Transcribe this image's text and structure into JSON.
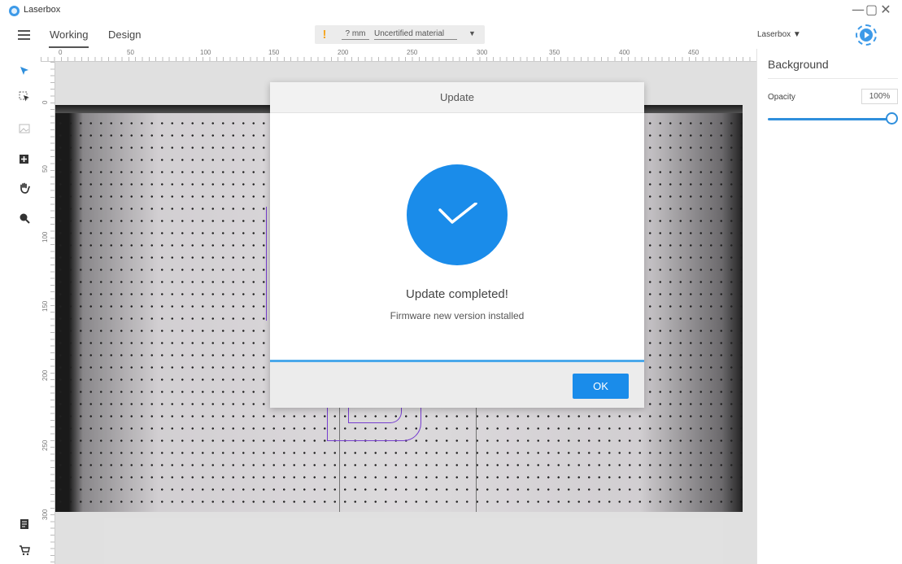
{
  "app": {
    "title": "Laserbox"
  },
  "window_controls": {
    "minimize": "—",
    "maximize": "▢",
    "close": "✕"
  },
  "header": {
    "tabs": [
      {
        "label": "Working",
        "active": true
      },
      {
        "label": "Design",
        "active": false
      }
    ],
    "warning_icon": "!",
    "thickness_value": "? mm",
    "material_value": "Uncertified material",
    "material_caret": "▼",
    "device_select": "Laserbox ▼"
  },
  "toolbar": {
    "tools": [
      "select-arrow-icon",
      "select-area-icon",
      "image-icon",
      "add-shape-icon",
      "hand-icon",
      "zoom-icon"
    ],
    "bottom_tools": [
      "notes-icon",
      "cart-icon"
    ]
  },
  "ruler": {
    "top_labels": [
      "0",
      "50",
      "100",
      "150",
      "200",
      "250",
      "300",
      "350",
      "400",
      "450"
    ],
    "left_labels": [
      "0",
      "50",
      "100",
      "150",
      "200",
      "250",
      "300"
    ]
  },
  "panel": {
    "title": "Background",
    "opacity_label": "Opacity",
    "opacity_value": "100%",
    "opacity_level": 1.0
  },
  "modal": {
    "title": "Update",
    "heading": "Update completed!",
    "subtext": "Firmware new version installed",
    "ok_label": "OK",
    "progress": 1.0
  },
  "colors": {
    "accent": "#1a8cea",
    "warning": "#f5a623",
    "outline": "#7a3fd6"
  }
}
